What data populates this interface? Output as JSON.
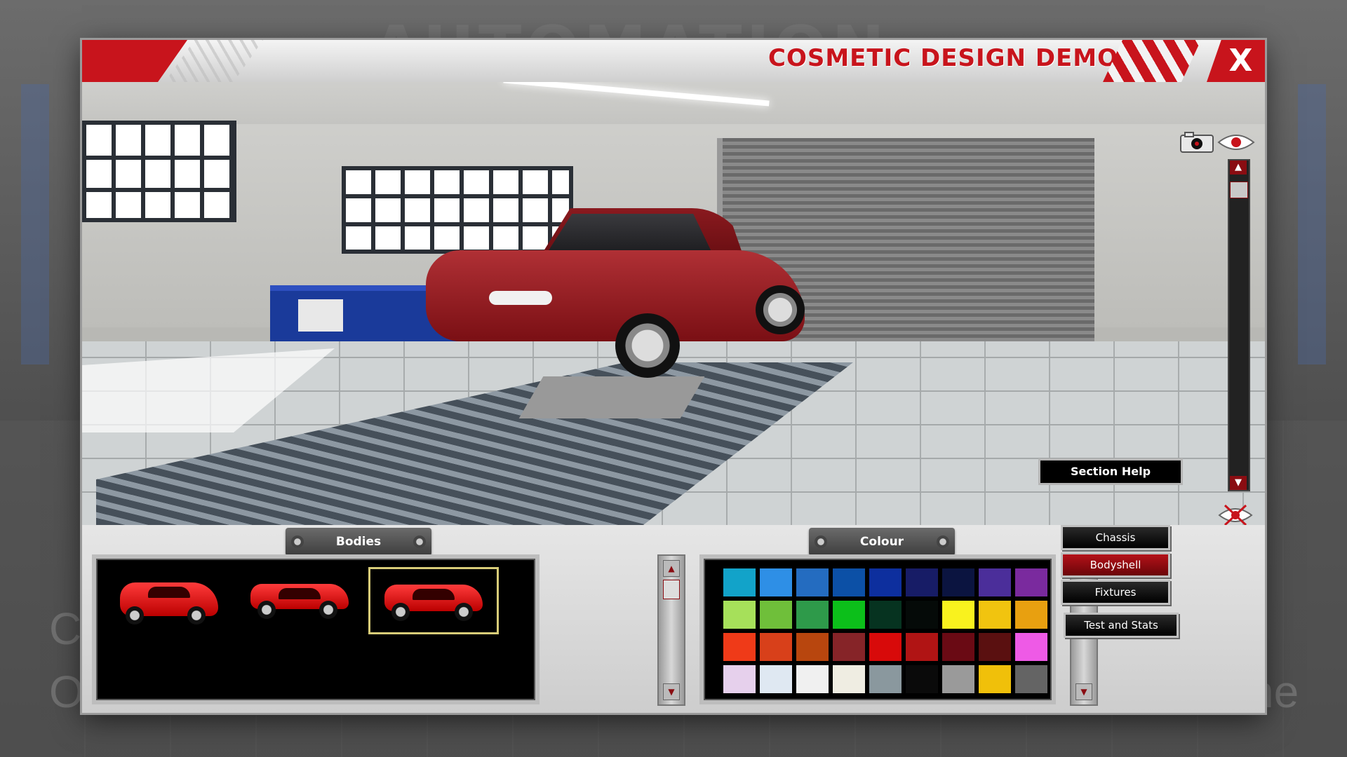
{
  "window": {
    "title": "COSMETIC DESIGN DEMO",
    "close_label": "X",
    "accent_color": "#c8141c"
  },
  "background": {
    "logo_text": "AUTOMATION",
    "left_fragment_1": "C",
    "left_fragment_2": "O",
    "right_fragment": "ne"
  },
  "viewport": {
    "camera_icon": "camera-icon",
    "view_icon": "eye-icon",
    "hide_icon": "eye-crossed-icon",
    "scroll_up": "▲",
    "scroll_down": "▼"
  },
  "bodies_panel": {
    "label": "Bodies",
    "items": [
      {
        "name": "hatchback-body",
        "color": "#e01818",
        "selected": false
      },
      {
        "name": "sedan-body",
        "color": "#d81818",
        "selected": false
      },
      {
        "name": "coupe-body",
        "color": "#e01818",
        "selected": true
      }
    ],
    "scroll_up": "▲",
    "scroll_down": "▼"
  },
  "colour_panel": {
    "label": "Colour",
    "swatches": [
      [
        "#12a3c9",
        "#2e8fe6",
        "#246cc0",
        "#0c50a6",
        "#0d2f9e",
        "#171c66",
        "#0b1440",
        "#4b2e9a",
        "#7a2a9e"
      ],
      [
        "#a6e05a",
        "#6fbf3a",
        "#2e9a4a",
        "#0cbf1a",
        "#063320",
        "#050a08",
        "#f9f21e",
        "#f1c40f",
        "#e8a010"
      ],
      [
        "#ef3a18",
        "#d8401a",
        "#b8460e",
        "#862428",
        "#d80a0a",
        "#b01414",
        "#6a0a14",
        "#5a1010",
        "#ee5ae6"
      ],
      [
        "#e6d0ec",
        "#dfe8f2",
        "#f0f0f0",
        "#efede2",
        "#8a989e",
        "#0a0a0a",
        "#9a9a9a",
        "#f0c00a",
        "#646464"
      ]
    ],
    "scroll_up": "▲",
    "scroll_down": "▼"
  },
  "section_help": {
    "title": "Section Help",
    "buttons": [
      {
        "label": "Chassis",
        "active": false
      },
      {
        "label": "Bodyshell",
        "active": true
      },
      {
        "label": "Fixtures",
        "active": false
      },
      {
        "label": "Test and Stats",
        "active": false
      }
    ]
  }
}
